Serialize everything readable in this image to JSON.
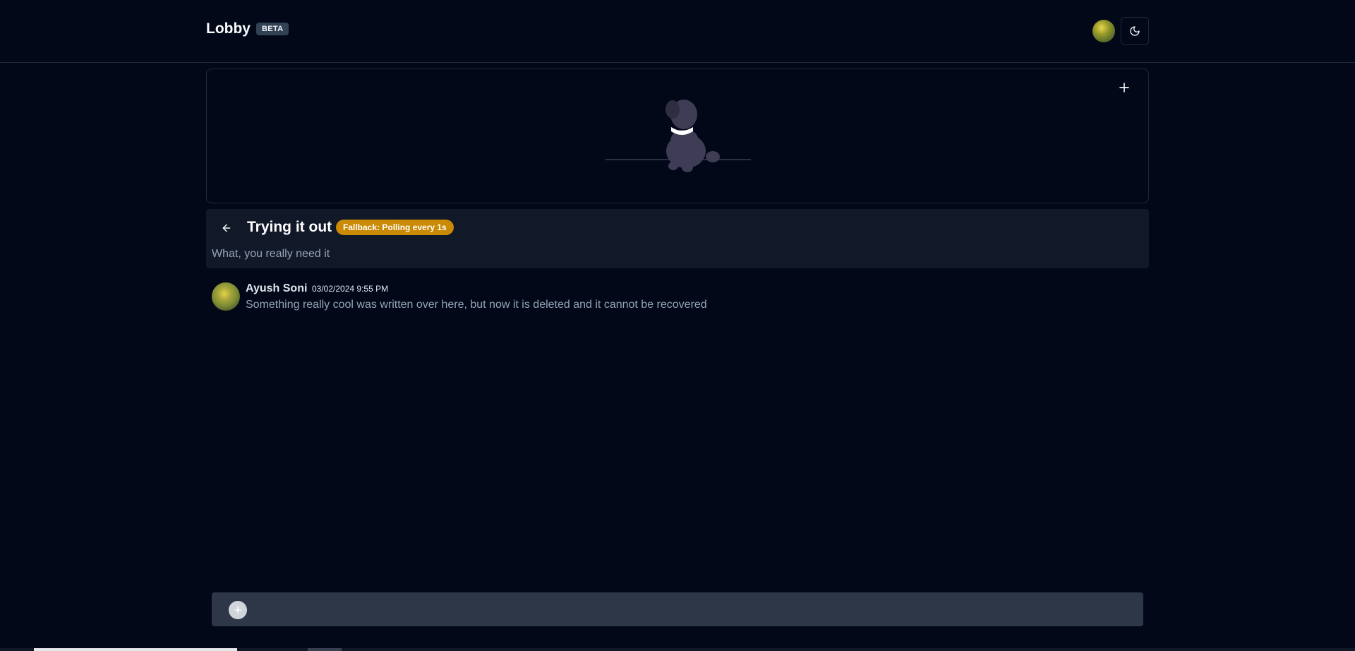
{
  "header": {
    "title": "Lobby",
    "badge": "BETA",
    "avatar_icon": "user-avatar",
    "theme_icon": "moon-icon"
  },
  "banner": {
    "illustration": "dog-illustration",
    "add_icon": "plus-icon"
  },
  "topic": {
    "back_icon": "arrow-left-icon",
    "title": "Trying it out",
    "status_badge": "Fallback: Polling every 1s",
    "description": "What, you really need it"
  },
  "messages": [
    {
      "author": "Ayush Soni",
      "timestamp": "03/02/2024 9:55 PM",
      "text": "Something really cool was written over here, but now it is deleted and it cannot be recovered"
    }
  ],
  "composer": {
    "add_icon": "plus-circle-icon",
    "value": "",
    "placeholder": ""
  },
  "colors": {
    "background": "#020817",
    "status_badge": "#ca8a04",
    "topic_bar": "#111827",
    "composer": "#2d3748"
  }
}
